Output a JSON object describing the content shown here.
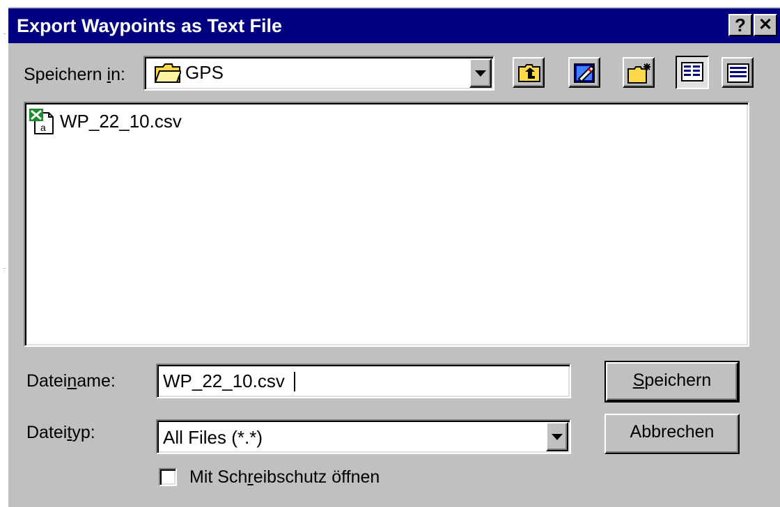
{
  "dialog": {
    "title": "Export Waypoints as Text File",
    "help_button": "?",
    "close_button": "✕"
  },
  "location": {
    "label_pre": "Speichern ",
    "label_u": "i",
    "label_post": "n:",
    "value": "GPS",
    "icon": "folder-icon"
  },
  "toolbar": {
    "buttons": [
      "up-one-level-icon",
      "desktop-icon",
      "new-folder-icon",
      "list-view-icon",
      "details-view-icon"
    ]
  },
  "files": [
    {
      "name": "WP_22_10.csv",
      "icon": "excel-csv-file-icon"
    }
  ],
  "filename": {
    "label_pre": "Datei",
    "label_u": "n",
    "label_post": "ame:",
    "value": "WP_22_10.csv"
  },
  "filetype": {
    "label_pre": "Datei",
    "label_u": "t",
    "label_post": "yp:",
    "value": "All Files (*.*)"
  },
  "readonly": {
    "label_pre": "Mit Sch",
    "label_u": "r",
    "label_post": "eibschutz öffnen",
    "checked": false
  },
  "buttons": {
    "save_u": "S",
    "save_rest": "peichern",
    "cancel": "Abbrechen"
  },
  "colors": {
    "titlebar": "#000080",
    "face": "#c0c0c0",
    "folder": "#ffd94a"
  }
}
